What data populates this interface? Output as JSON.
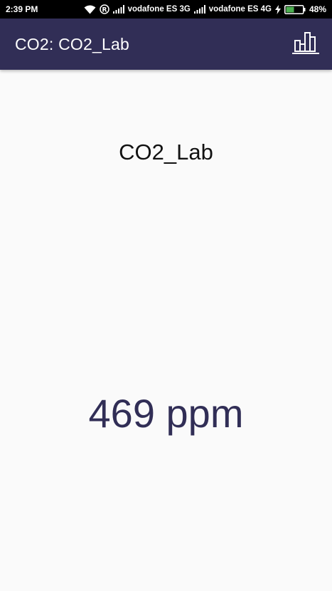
{
  "status_bar": {
    "time": "2:39 PM",
    "carrier1": "vodafone ES 3G",
    "carrier2": "vodafone ES 4G",
    "battery": "48%",
    "battery_level": 0.48,
    "battery_color": "#4caf50",
    "icons": [
      "wifi-icon",
      "roaming-icon",
      "signal-icon",
      "signal-icon",
      "charging-icon",
      "battery-icon"
    ]
  },
  "app_bar": {
    "title": "CO2: CO2_Lab",
    "background": "#312e56",
    "action_icon": "bar-chart-icon"
  },
  "main": {
    "device_name": "CO2_Lab",
    "reading": "469 ppm",
    "reading_color": "#312e56"
  }
}
